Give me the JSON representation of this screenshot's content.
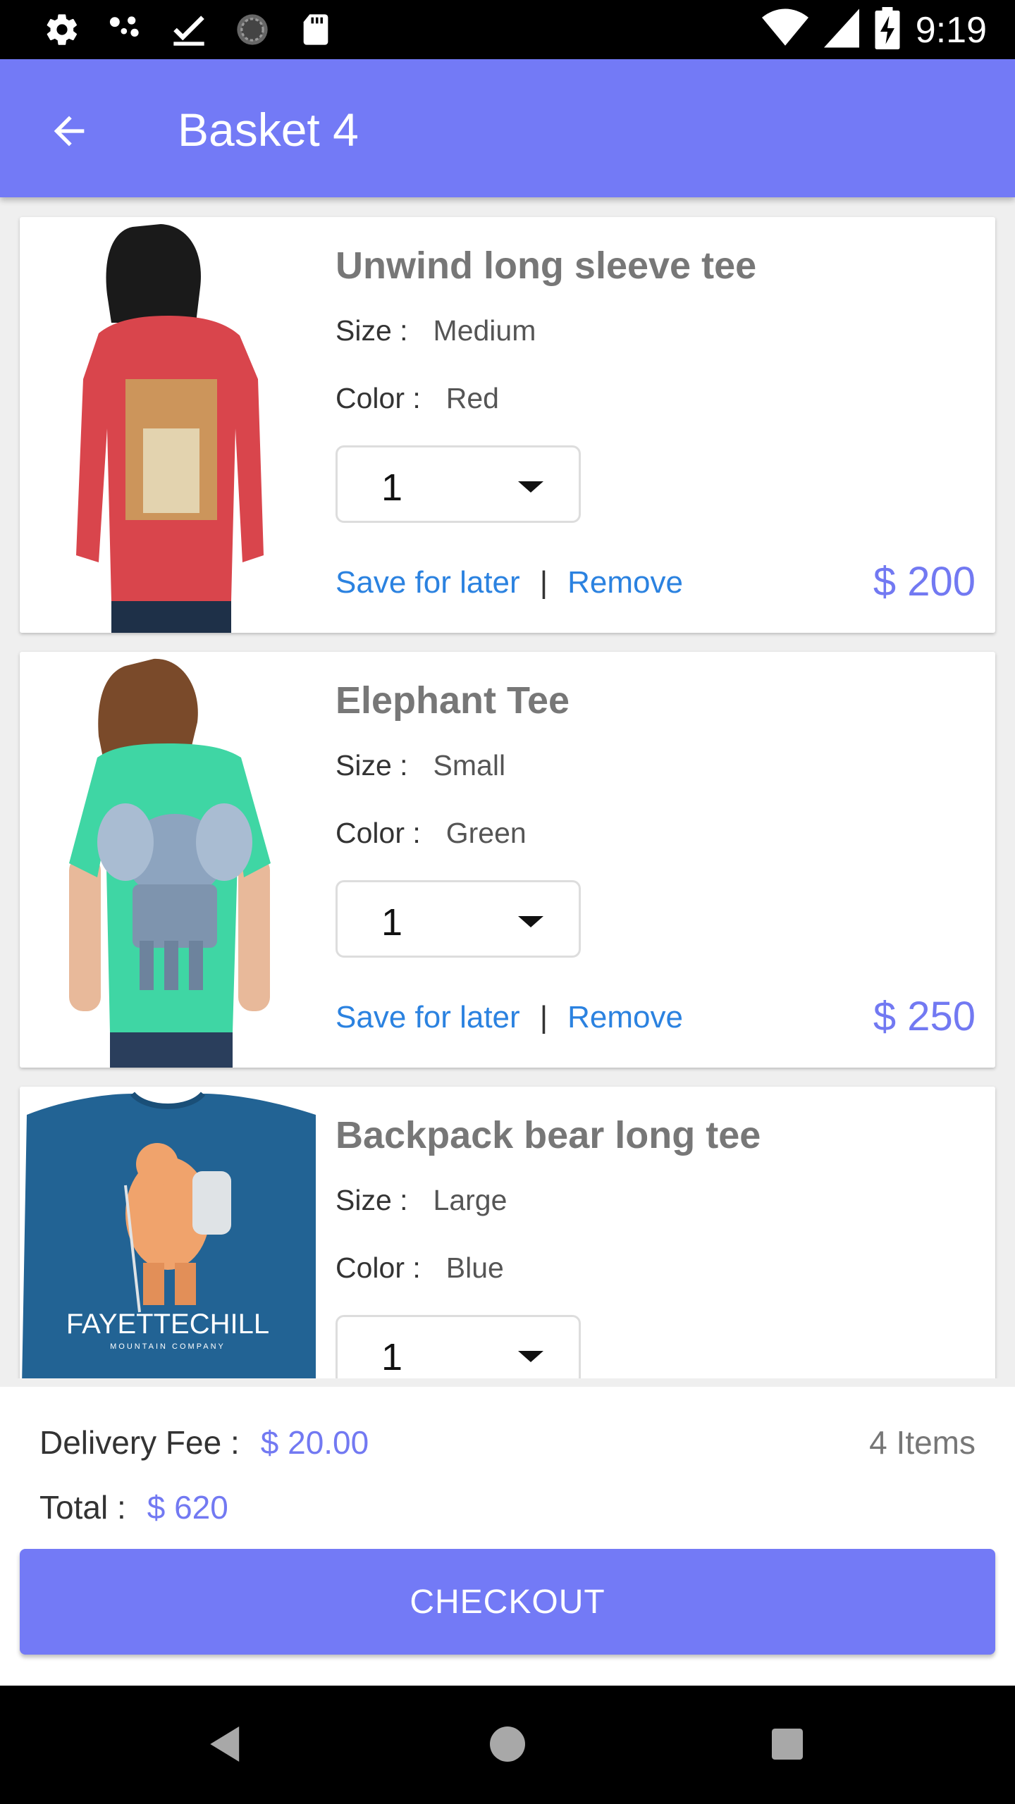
{
  "status_bar": {
    "time": "9:19",
    "left_icons": [
      "settings-icon",
      "share-icon",
      "checkmark-icon",
      "sync-icon",
      "sd-card-icon"
    ],
    "right_icons": [
      "wifi-icon",
      "signal-icon",
      "battery-charging-icon"
    ]
  },
  "app_bar": {
    "title": "Basket 4",
    "back_icon": "arrow-back-icon"
  },
  "items": [
    {
      "name": "Unwind long sleeve tee",
      "size_label": "Size :",
      "size": "Medium",
      "color_label": "Color :",
      "color": "Red",
      "quantity": "1",
      "save_label": "Save for later",
      "separator": "|",
      "remove_label": "Remove",
      "price": "$ 200",
      "shirt_color": "#d9454c"
    },
    {
      "name": "Elephant Tee",
      "size_label": "Size :",
      "size": "Small",
      "color_label": "Color :",
      "color": "Green",
      "quantity": "1",
      "save_label": "Save for later",
      "separator": "|",
      "remove_label": "Remove",
      "price": "$ 250",
      "shirt_color": "#3fd6a4"
    },
    {
      "name": "Backpack bear long tee",
      "size_label": "Size :",
      "size": "Large",
      "color_label": "Color :",
      "color": "Blue",
      "quantity": "1",
      "shirt_color": "#226394",
      "shirt_print_text": "FAYETTECHILL",
      "shirt_print_subtext": "MOUNTAIN COMPANY"
    }
  ],
  "summary": {
    "delivery_label": "Delivery Fee :",
    "delivery_amount": "$ 20.00",
    "items_count": "4 Items",
    "total_label": "Total :",
    "total_amount": "$ 620",
    "checkout_label": "CHECKOUT"
  },
  "colors": {
    "accent": "#737af6",
    "link": "#2b82e0"
  }
}
